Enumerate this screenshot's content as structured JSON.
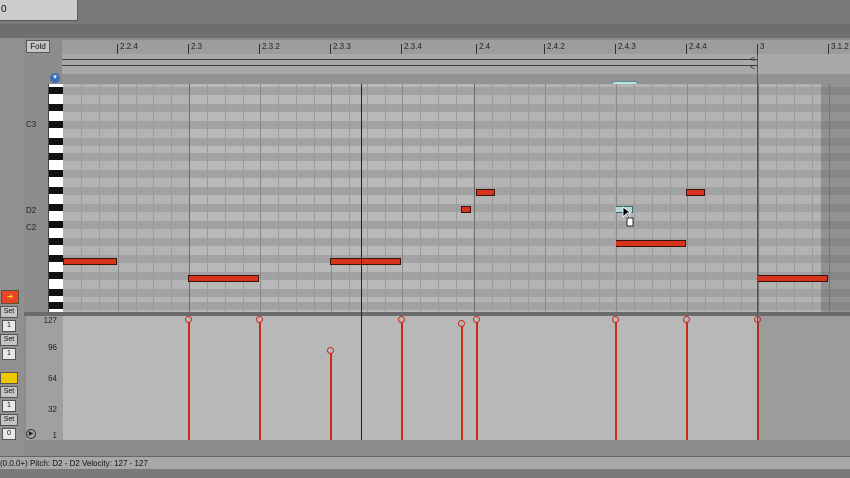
{
  "top": {
    "field_value": "0"
  },
  "clip": {
    "fold_label": "Fold"
  },
  "ruler": {
    "labels": [
      "2.2.4",
      "2.3",
      "2.3.2",
      "2.3.3",
      "2.3.4",
      "2.4",
      "2.4.2",
      "2.4.3",
      "2.4.4",
      "3",
      "3.1.2"
    ]
  },
  "keys": {
    "labels": [
      "C3",
      "D2",
      "C2"
    ]
  },
  "velocity": {
    "labels": [
      "127",
      "96",
      "64",
      "32",
      "1"
    ]
  },
  "side": {
    "buttons": [
      "Set",
      "Set",
      "Set",
      "Set"
    ],
    "values": [
      "1",
      "1",
      "1",
      "0"
    ]
  },
  "status": {
    "text": "(0.0.0+)    Pitch: D2 - D2    Velocity: 127 - 127"
  },
  "colors": {
    "note": "#d8331c",
    "selected": "#b8d8d8",
    "accent": "#f0b000"
  }
}
